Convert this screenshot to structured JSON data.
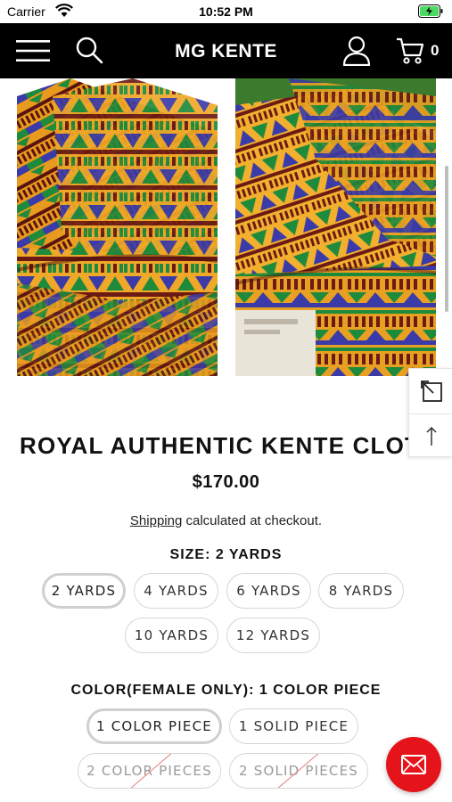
{
  "status_bar": {
    "carrier": "Carrier",
    "time": "10:52 PM"
  },
  "header": {
    "brand": "MG KENTE",
    "cart_count": "0",
    "icons": [
      "menu-icon",
      "search-icon",
      "account-icon",
      "cart-icon"
    ]
  },
  "product": {
    "title": "ROYAL AUTHENTIC KENTE CLOTH",
    "price": "$170.00",
    "shipping_link": "Shipping",
    "shipping_rest": " calculated at checkout."
  },
  "size": {
    "heading": "SIZE: 2 YARDS",
    "options": [
      "2 YARDS",
      "4 YARDS",
      "6 YARDS",
      "8 YARDS",
      "10 YARDS",
      "12 YARDS"
    ],
    "selected": "2 YARDS"
  },
  "color": {
    "heading": "COLOR(FEMALE ONLY): 1 COLOR PIECE",
    "options": [
      "1 COLOR PIECE",
      "1 SOLID PIECE",
      "2 COLOR PIECES",
      "2 SOLID PIECES"
    ],
    "selected": "1 COLOR PIECE",
    "unavailable": [
      "2 COLOR PIECES",
      "2 SOLID PIECES"
    ]
  },
  "colors": {
    "header_bg": "#000000",
    "fab": "#e5141b",
    "kente_gold": "#f0a828",
    "kente_green": "#1e8a3c",
    "kente_blue": "#3a3aa8",
    "kente_maroon": "#6b1a14"
  }
}
